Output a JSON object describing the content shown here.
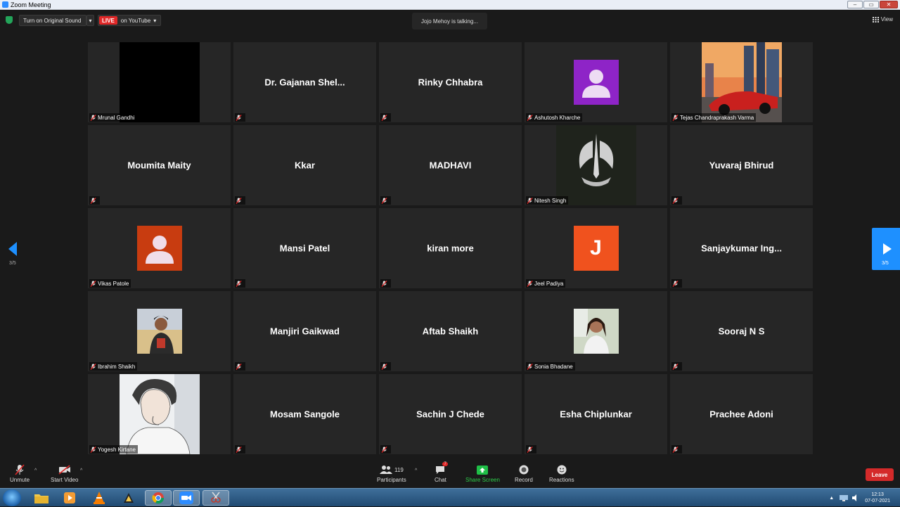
{
  "window": {
    "title": "Zoom Meeting"
  },
  "topbar": {
    "original_sound": "Turn on Original Sound",
    "live_badge": "LIVE",
    "live_target": "on YouTube",
    "talking": "Jojo Mehoy is talking...",
    "view": "View"
  },
  "pager": {
    "left": "3/5",
    "right": "3/5"
  },
  "participants": [
    {
      "name": "Mrunal Gandhi",
      "display": "video"
    },
    {
      "name": "Dr. Gajanan Shel...",
      "display": "name"
    },
    {
      "name": "Rinky Chhabra",
      "display": "name"
    },
    {
      "name": "Ashutosh Kharche",
      "display": "avatar",
      "avatar_color": "#8e24c7"
    },
    {
      "name": "Tejas Chandraprakash Varma",
      "display": "photo"
    },
    {
      "name": "Moumita Maity",
      "display": "name"
    },
    {
      "name": "Kkar",
      "display": "name"
    },
    {
      "name": "MADHAVI",
      "display": "name"
    },
    {
      "name": "Nitesh Singh",
      "display": "photo"
    },
    {
      "name": "Yuvaraj Bhirud",
      "display": "name"
    },
    {
      "name": "Vikas Patole",
      "display": "avatar",
      "avatar_color": "#c83c10"
    },
    {
      "name": "Mansi Patel",
      "display": "name"
    },
    {
      "name": "kiran more",
      "display": "name"
    },
    {
      "name": "Jeel Padiya",
      "display": "initial",
      "initial": "J",
      "avatar_color": "#f0521e"
    },
    {
      "name": "Sanjaykumar  Ing...",
      "display": "name"
    },
    {
      "name": "Ibrahim Shaikh",
      "display": "photo"
    },
    {
      "name": "Manjiri Gaikwad",
      "display": "name"
    },
    {
      "name": "Aftab Shaikh",
      "display": "name"
    },
    {
      "name": "Sonia Bhadane",
      "display": "photo"
    },
    {
      "name": "Sooraj N S",
      "display": "name"
    },
    {
      "name": "Yogesh Kirtane",
      "display": "photo"
    },
    {
      "name": "Mosam Sangole",
      "display": "name"
    },
    {
      "name": "Sachin J Chede",
      "display": "name"
    },
    {
      "name": "Esha Chiplunkar",
      "display": "name"
    },
    {
      "name": "Prachee Adoni",
      "display": "name"
    }
  ],
  "toolbar": {
    "unmute": "Unmute",
    "start_video": "Start Video",
    "participants_count": "119",
    "participants": "Participants",
    "chat_badge": "7",
    "chat": "Chat",
    "share_screen": "Share Screen",
    "record": "Record",
    "reactions": "Reactions",
    "leave": "Leave"
  },
  "taskbar": {
    "time": "12:13",
    "date": "07-07-2021"
  }
}
